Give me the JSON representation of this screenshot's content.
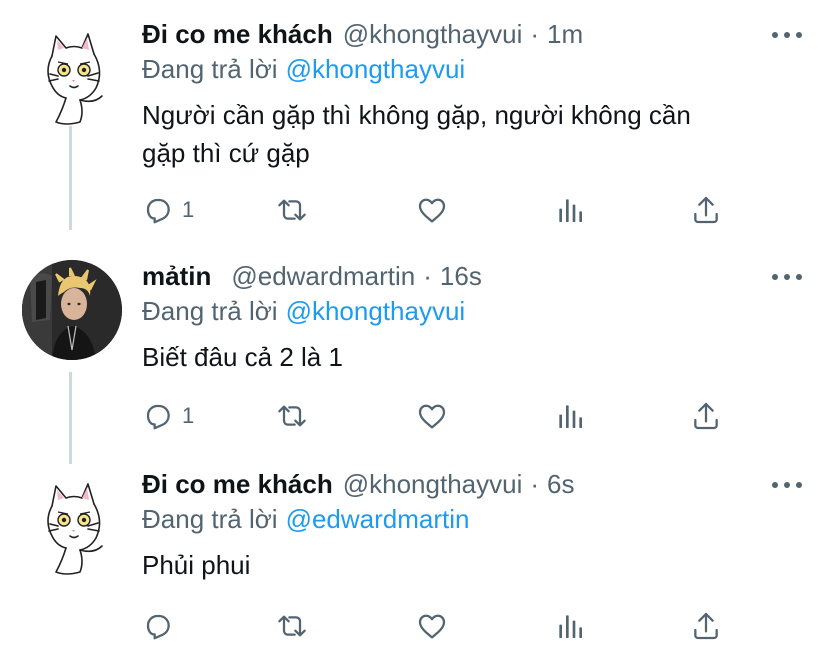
{
  "tweets": [
    {
      "name": "Đi co me khách",
      "handle": "@khongthayvui",
      "separator": "·",
      "time": "1m",
      "reply_prefix": "Đang trả lời",
      "reply_to": "@khongthayvui",
      "text_lines": [
        "Người cần gặp thì không gặp, người không cần",
        "gặp thì cứ gặp"
      ],
      "reply_count": "1",
      "avatar": "cat-drawing"
    },
    {
      "name": "mảtin",
      "handle": "@edwardmartin",
      "separator": "·",
      "time": "16s",
      "reply_prefix": "Đang trả lời",
      "reply_to": "@khongthayvui",
      "text_lines": [
        "Biết đâu cả 2 là 1"
      ],
      "reply_count": "1",
      "avatar": "person-photo"
    },
    {
      "name": "Đi co me khách",
      "handle": "@khongthayvui",
      "separator": "·",
      "time": "6s",
      "reply_prefix": "Đang trả lời",
      "reply_to": "@edwardmartin",
      "text_lines": [
        "Phủi phui"
      ],
      "reply_count": "",
      "avatar": "cat-drawing"
    }
  ],
  "icons": {
    "reply": "reply-icon",
    "retweet": "retweet-icon",
    "like": "like-icon",
    "analytics": "analytics-icon",
    "share": "share-icon",
    "more": "more-icon"
  },
  "colors": {
    "text": "#0f1419",
    "secondary": "#536471",
    "link": "#1d9bf0",
    "thread_line": "#cfd9de"
  }
}
